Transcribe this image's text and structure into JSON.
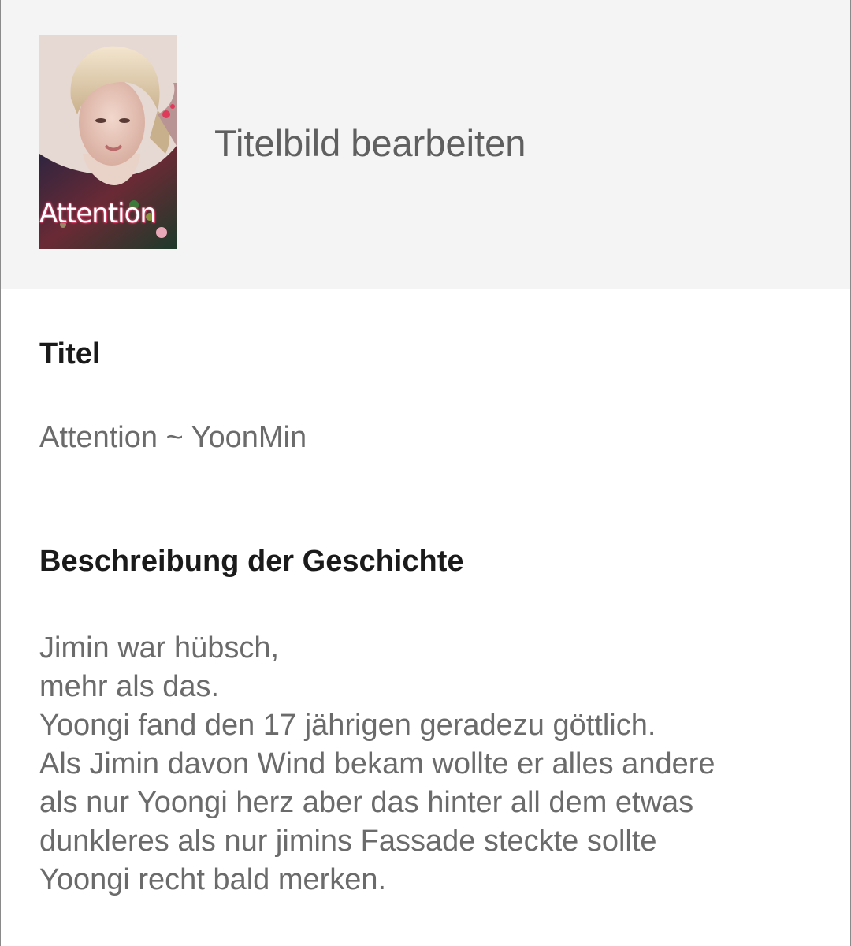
{
  "cover": {
    "image_text": "Attention",
    "edit_label": "Titelbild bearbeiten",
    "icon": "story-cover-image"
  },
  "title_section": {
    "label": "Titel",
    "value": "Attention ~ YoonMin"
  },
  "description_section": {
    "label": "Beschreibung der Geschichte",
    "lines": [
      "Jimin war hübsch,",
      "mehr als das.",
      "Yoongi fand den 17 jährigen geradezu göttlich.",
      "Als Jimin davon Wind bekam wollte er alles andere",
      "als nur Yoongi herz aber das hinter all dem etwas",
      "dunkleres als nur jimins Fassade steckte sollte",
      "Yoongi recht bald merken."
    ]
  },
  "colors": {
    "header_bg": "#f4f4f4",
    "label_text": "#1a1a1a",
    "value_text": "#6b6b6b"
  }
}
